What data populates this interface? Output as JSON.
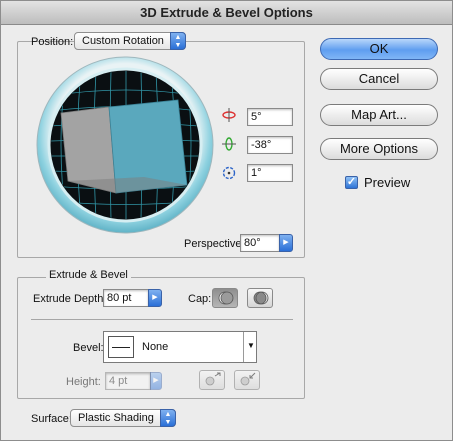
{
  "window": {
    "title": "3D Extrude & Bevel Options"
  },
  "position": {
    "label": "Position:",
    "value": "Custom Rotation",
    "x_angle": "5°",
    "y_angle": "-38°",
    "z_angle": "1°",
    "perspective_label": "Perspective:",
    "perspective_value": "80°"
  },
  "buttons": {
    "ok": "OK",
    "cancel": "Cancel",
    "map_art": "Map Art...",
    "more_options": "More Options"
  },
  "preview": {
    "label": "Preview",
    "checked": true
  },
  "extrude": {
    "section_label": "Extrude & Bevel",
    "depth_label": "Extrude Depth:",
    "depth_value": "80 pt",
    "cap_label": "Cap:",
    "bevel_label": "Bevel:",
    "bevel_value": "None",
    "height_label": "Height:",
    "height_value": "4 pt"
  },
  "surface": {
    "label": "Surface:",
    "value": "Plastic Shading"
  },
  "colors": {
    "accent_blue": "#2a6fd7",
    "cube_front": "#5aa8bd",
    "cube_side": "#a3a3a3",
    "grid_cyan": "#3fc3d9"
  }
}
